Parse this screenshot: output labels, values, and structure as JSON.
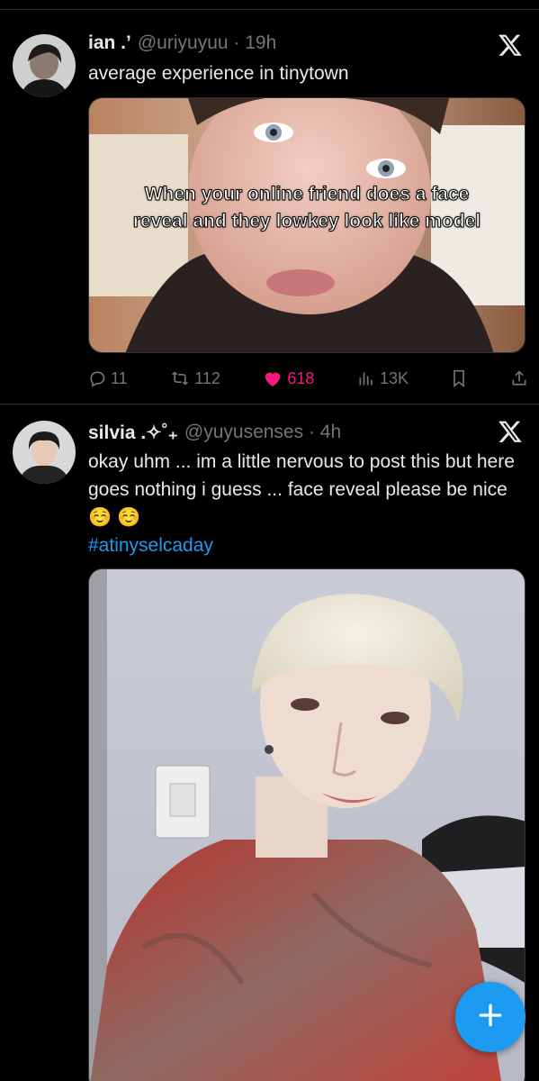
{
  "tweets": [
    {
      "display_name": "ian .’",
      "handle": "@uriyuyuu · 19h",
      "text": "average experience in tinytown",
      "media_caption": "When your online friend does a face reveal and they lowkey look like model",
      "media_description": "selfie of a person with light eyes and dark clothing",
      "avatar_icon": "avatar-photo",
      "metrics": {
        "replies": "11",
        "retweets": "112",
        "likes": "618",
        "views": "13K"
      },
      "liked": true,
      "like_color": "#f91880"
    },
    {
      "display_name": "silvia .✧˚₊",
      "handle": "@yuyusenses · 4h",
      "text": "okay uhm ... im a little nervous to post this but here goes nothing i guess ... face reveal please be nice ☺️ ☺️",
      "hashtag": "#atinyselcaday",
      "media_description": "selfie of a person with platinum blonde bowl-cut hair wearing a red sheer top",
      "avatar_icon": "avatar-photo"
    }
  ],
  "fab": {
    "icon": "plus-icon",
    "color": "#1d9bf0"
  },
  "accent_color": "#1d9bf0"
}
